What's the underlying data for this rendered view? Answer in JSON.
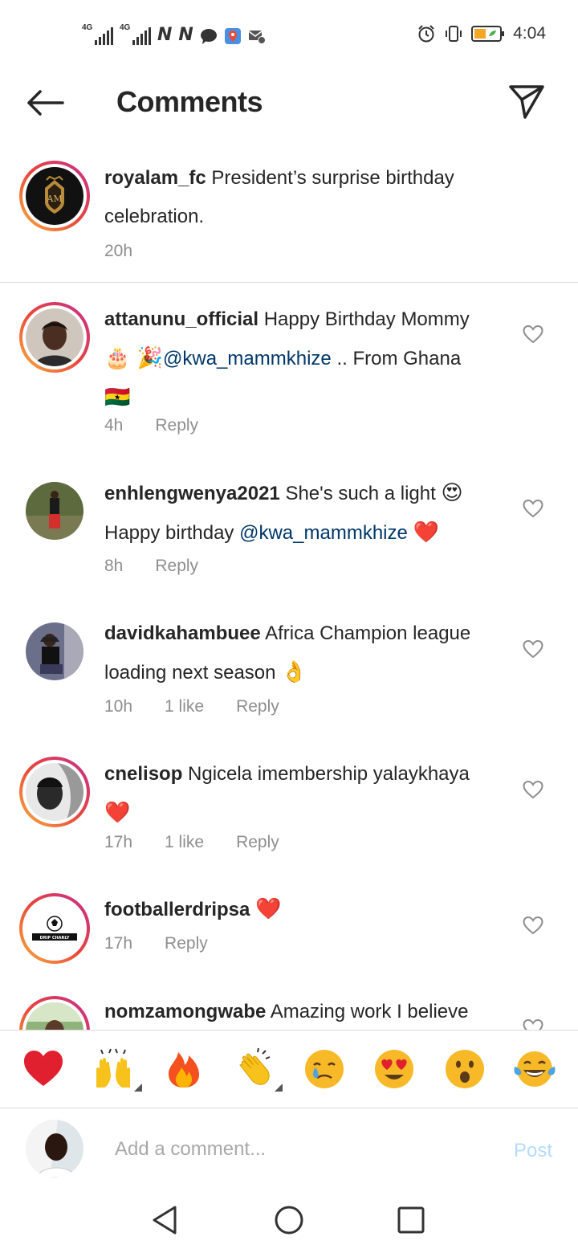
{
  "status_bar": {
    "network1": "4G",
    "network2": "4G",
    "notification_glyph": "N",
    "time": "4:04"
  },
  "header": {
    "title": "Comments"
  },
  "caption": {
    "username": "royalam_fc",
    "text": "President’s surprise birthday celebration.",
    "time": "20h"
  },
  "comments": [
    {
      "username": "attanunu_official",
      "text_before": "Happy Birthday Mommy",
      "emojis_1": "🎂 🎉",
      "mention": "@kwa_mammkhize",
      "text_after": ".. From Ghana",
      "flag": "🇬🇭",
      "time": "4h",
      "reply": "Reply"
    },
    {
      "username": "enhlengwenya2021",
      "text_before": "She's such a light",
      "emoji_1": "😍",
      "text_mid": "Happy birthday",
      "mention": "@kwa_mammkhize",
      "emoji_2": "❤️",
      "time": "8h",
      "reply": "Reply"
    },
    {
      "username": "davidkahambuee",
      "text": "Africa Champion league loading next season",
      "emoji": "👌",
      "time": "10h",
      "likes": "1 like",
      "reply": "Reply"
    },
    {
      "username": "cnelisop",
      "text": "Ngicela imembership yalaykhaya",
      "emoji": "❤️",
      "time": "17h",
      "likes": "1 like",
      "reply": "Reply"
    },
    {
      "username": "footballerdripsa",
      "emoji": "❤️",
      "avatar_text": "DRIP CHARLY",
      "time": "17h",
      "reply": "Reply"
    },
    {
      "username": "nomzamongwabe",
      "text": "Amazing work I believe"
    }
  ],
  "reactions": [
    "heart",
    "raised-hands",
    "fire",
    "clapping-hands",
    "crying-face",
    "heart-eyes-face",
    "surprised-face",
    "tears-of-joy-face"
  ],
  "composer": {
    "placeholder": "Add a comment...",
    "post_label": "Post"
  },
  "colors": {
    "mention": "#00376b",
    "meta": "#8e8e8e",
    "post_disabled": "#b3dbff",
    "story_ring_start": "#f9b13c",
    "story_ring_end": "#c62d8f"
  }
}
